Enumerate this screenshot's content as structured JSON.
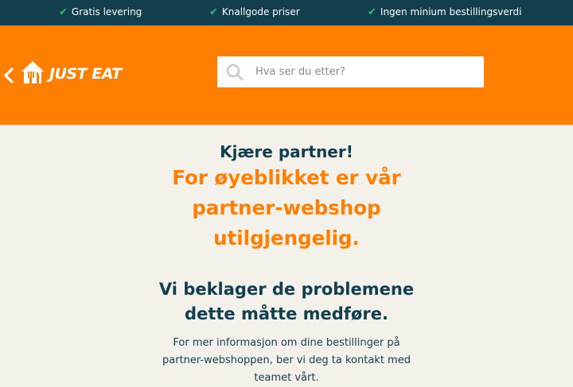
{
  "topbar": {
    "usps": [
      {
        "icon": "check-icon",
        "label": "Gratis levering"
      },
      {
        "icon": "check-icon",
        "label": "Knallgode priser"
      },
      {
        "icon": "check-icon",
        "label": "Ingen minium bestillingsverdi"
      }
    ],
    "check_color": "#29c26a",
    "background": "#123e4e"
  },
  "header": {
    "background": "#ff8000",
    "logo_text": "JUST EAT",
    "back_icon": "chevron-left-icon",
    "search": {
      "placeholder": "Hva ser du etter?",
      "icon": "search-icon"
    }
  },
  "main": {
    "greeting": "Kjære partner!",
    "headline": "For øyeblikket er vår partner-webshop utilgjengelig.",
    "apology": "Vi beklager de problemene dette måtte medføre.",
    "info": "For mer informasjon om dine bestillinger på partner-webshoppen, ber vi deg ta kontakt med teamet vårt."
  }
}
